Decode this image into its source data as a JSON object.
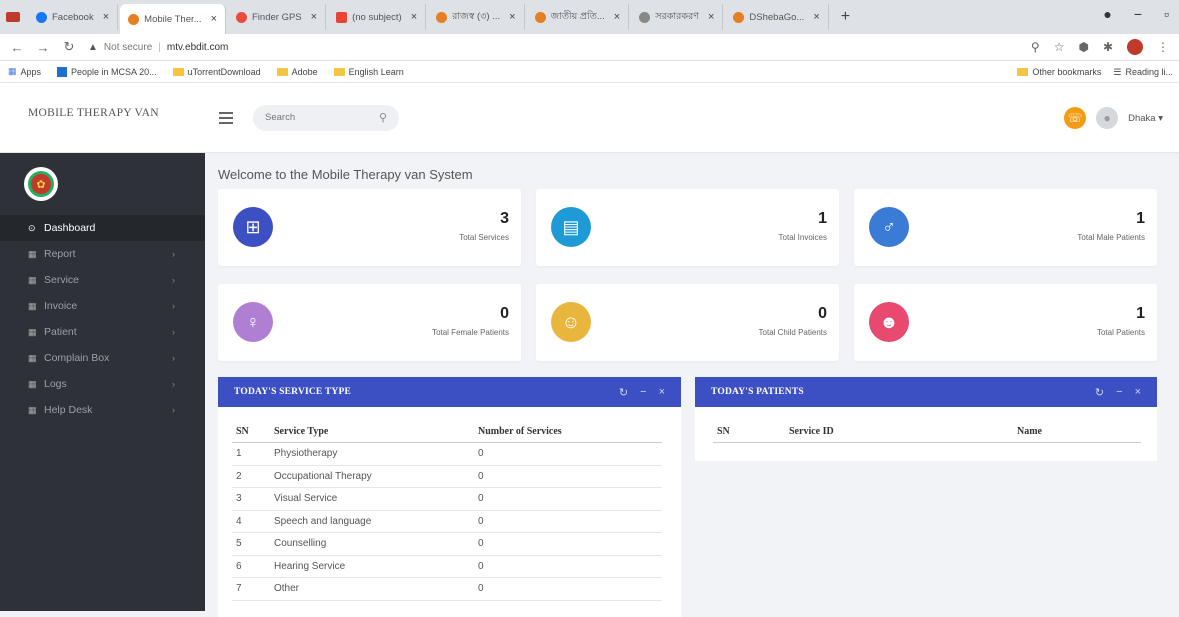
{
  "browser": {
    "tabs": [
      {
        "label": "Facebook",
        "color": "#1877f2",
        "active": false
      },
      {
        "label": "Mobile Ther...",
        "color": "#e67e22",
        "active": true
      },
      {
        "label": "Finder GPS",
        "color": "#e74c3c",
        "active": false
      },
      {
        "label": "(no subject)",
        "color": "#ea4335",
        "active": false
      },
      {
        "label": "রাজস্ব (৩) ...",
        "color": "#e67e22",
        "active": false
      },
      {
        "label": "জাতীয় প্রতি...",
        "color": "#e67e22",
        "active": false
      },
      {
        "label": "সরকারকরণ",
        "color": "#888888",
        "active": false
      },
      {
        "label": "DShebaGo...",
        "color": "#e67e22",
        "active": false
      }
    ],
    "new_tab": "+",
    "address": {
      "insecure": "Not secure",
      "url": "mtv.ebdit.com"
    },
    "bookmarks": [
      {
        "label": "Apps"
      },
      {
        "label": "People in MCSA 20..."
      },
      {
        "label": "uTorrentDownload"
      },
      {
        "label": "Adobe"
      },
      {
        "label": "English Learn"
      }
    ],
    "bookmarks_right": [
      {
        "label": "Other bookmarks"
      },
      {
        "label": "Reading li..."
      }
    ]
  },
  "app": {
    "brand": "MOBILE THERAPY VAN",
    "search_placeholder": "Search",
    "user_name": "Dhaka ▾"
  },
  "sidebar": {
    "items": [
      {
        "label": "Dashboard",
        "active": true
      },
      {
        "label": "Report",
        "active": false
      },
      {
        "label": "Service",
        "active": false
      },
      {
        "label": "Invoice",
        "active": false
      },
      {
        "label": "Patient",
        "active": false
      },
      {
        "label": "Complain Box",
        "active": false
      },
      {
        "label": "Logs",
        "active": false
      },
      {
        "label": "Help Desk",
        "active": false
      }
    ]
  },
  "dashboard": {
    "welcome": "Welcome to the Mobile Therapy van System",
    "cards": [
      {
        "value": "3",
        "label": "Total Services",
        "color": "#3d50c3",
        "icon": "medical-kit-icon"
      },
      {
        "value": "1",
        "label": "Total Invoices",
        "color": "#1e9bd7",
        "icon": "invoice-icon"
      },
      {
        "value": "1",
        "label": "Total Male Patients",
        "color": "#3a7bd5",
        "icon": "male-icon"
      },
      {
        "value": "0",
        "label": "Total Female Patients",
        "color": "#b07fd4",
        "icon": "female-icon"
      },
      {
        "value": "0",
        "label": "Total Child Patients",
        "color": "#e8b63c",
        "icon": "child-icon"
      },
      {
        "value": "1",
        "label": "Total Patients",
        "color": "#e84a6f",
        "icon": "group-icon"
      }
    ],
    "service_panel": {
      "title": "TODAY'S SERVICE TYPE",
      "columns": [
        "SN",
        "Service Type",
        "Number of Services"
      ],
      "rows": [
        [
          "1",
          "Physiotherapy",
          "0"
        ],
        [
          "2",
          "Occupational Therapy",
          "0"
        ],
        [
          "3",
          "Visual Service",
          "0"
        ],
        [
          "4",
          "Speech and language",
          "0"
        ],
        [
          "5",
          "Counselling",
          "0"
        ],
        [
          "6",
          "Hearing Service",
          "0"
        ],
        [
          "7",
          "Other",
          "0"
        ]
      ]
    },
    "patients_panel": {
      "title": "TODAY'S PATIENTS",
      "columns": [
        "SN",
        "Service ID",
        "Name"
      ]
    }
  }
}
